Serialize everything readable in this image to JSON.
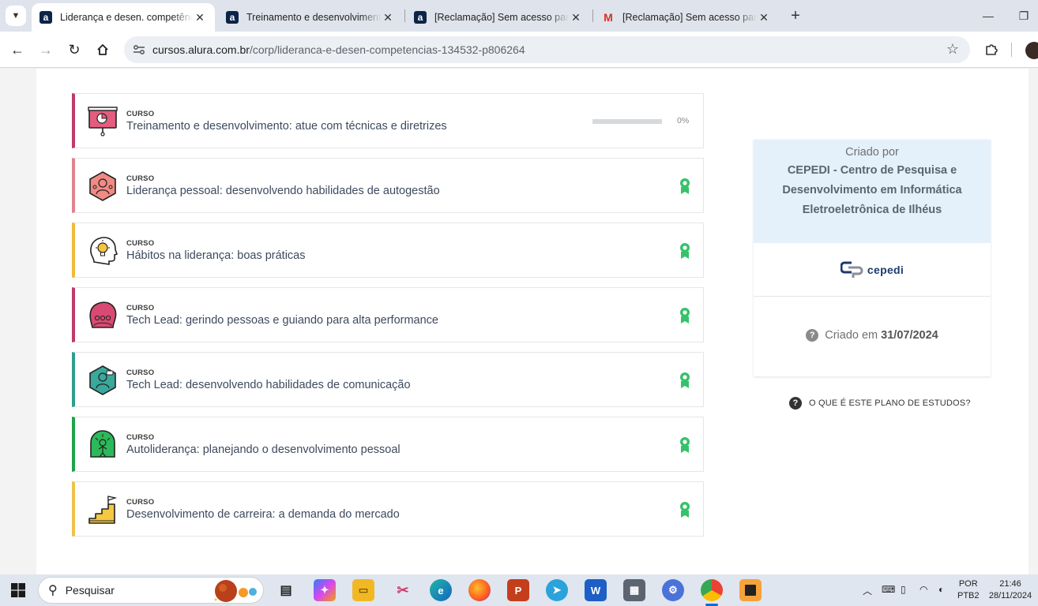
{
  "browser": {
    "tabs": [
      {
        "title": "Liderança e desen. competências",
        "favicon": "alura-icon",
        "active": true
      },
      {
        "title": "Treinamento e desenvolvimento",
        "favicon": "alura-icon",
        "active": false
      },
      {
        "title": "[Reclamação] Sem acesso para",
        "favicon": "alura-icon",
        "active": false
      },
      {
        "title": "[Reclamação] Sem acesso para",
        "favicon": "gmail-icon",
        "active": false
      }
    ],
    "url_host": "cursos.alura.com.br",
    "url_path": "/corp/lideranca-e-desen-competencias-134532-p806264"
  },
  "courses": [
    {
      "kicker": "CURSO",
      "title": "Treinamento e desenvolvimento: atue com técnicas e diretrizes",
      "color": "#c0396b",
      "icon": "presentation-board-icon",
      "progress": 0,
      "progress_label": "0%",
      "status": "in-progress"
    },
    {
      "kicker": "CURSO",
      "title": "Liderança pessoal: desenvolvendo habilidades de autogestão",
      "color": "#e0838f",
      "icon": "leadership-hexagon-icon",
      "status": "certificate"
    },
    {
      "kicker": "CURSO",
      "title": "Hábitos na liderança: boas práticas",
      "color": "#f0b93a",
      "icon": "lightbulb-head-icon",
      "status": "certificate"
    },
    {
      "kicker": "CURSO",
      "title": "Tech Lead: gerindo pessoas e guiando para alta performance",
      "color": "#c0396b",
      "icon": "team-head-icon",
      "status": "certificate"
    },
    {
      "kicker": "CURSO",
      "title": "Tech Lead: desenvolvendo habilidades de comunicação",
      "color": "#2f9e8f",
      "icon": "communication-hexagon-icon",
      "status": "certificate"
    },
    {
      "kicker": "CURSO",
      "title": "Autoliderança: planejando o desenvolvimento pessoal",
      "color": "#1fa34a",
      "icon": "growth-head-icon",
      "status": "certificate"
    },
    {
      "kicker": "CURSO",
      "title": "Desenvolvimento de carreira: a demanda do mercado",
      "color": "#f0c14b",
      "icon": "career-stairs-icon",
      "status": "certificate"
    }
  ],
  "sidebar": {
    "created_by_label": "Criado por",
    "creator": "CEPEDI - Centro de Pesquisa e Desenvolvimento em Informática Eletroeletrônica de Ilhéus",
    "logo_text": "cepedi",
    "created_on_label": "Criado em",
    "created_on_date": "31/07/2024",
    "plan_help": "O QUE É ESTE PLANO DE ESTUDOS?"
  },
  "taskbar": {
    "search_placeholder": "Pesquisar",
    "lang_line1": "POR",
    "lang_line2": "PTB2",
    "time": "21:46",
    "date": "28/11/2024"
  },
  "colors": {
    "certificate": "#35c26a",
    "accent_blue": "#2ea8e0",
    "sidebar_head": "#e4f0fa"
  }
}
